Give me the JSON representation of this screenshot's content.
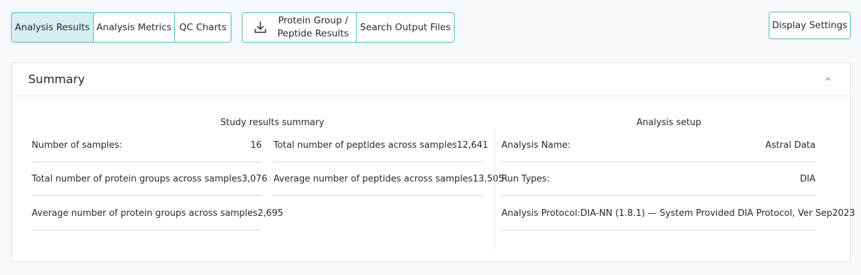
{
  "toolbar": {
    "tabs": [
      {
        "label": "Analysis Results",
        "active": true
      },
      {
        "label": "Analysis Metrics",
        "active": false
      },
      {
        "label": "QC Charts",
        "active": false
      }
    ],
    "protein_group_label": "Protein Group / Peptide Results",
    "search_output_label": "Search Output Files",
    "display_settings_label": "Display Settings"
  },
  "summary": {
    "title": "Summary",
    "study": {
      "title": "Study results summary",
      "left_rows": [
        {
          "label": "Number of samples:",
          "value": "16"
        },
        {
          "label": "Total number of protein groups across samples",
          "value": "3,076"
        },
        {
          "label": "Average number of protein groups across samples",
          "value": "2,695"
        }
      ],
      "right_rows": [
        {
          "label": "Total number of peptides across samples",
          "value": "12,641"
        },
        {
          "label": "Average number of peptides across samples",
          "value": "13,505"
        }
      ]
    },
    "setup": {
      "title": "Analysis setup",
      "rows": [
        {
          "label": "Analysis Name:",
          "value": "Astral Data"
        },
        {
          "label": "Run Types:",
          "value": "DIA"
        },
        {
          "label": "Analysis Protocol:",
          "value": "DIA-NN (1.8.1) — System Provided DIA Protocol, Ver Sep2023"
        }
      ]
    }
  },
  "colors": {
    "accent": "#53b8bd",
    "active_tab_bg": "#d7eef0"
  },
  "icons": {
    "download": "download-icon",
    "collapse": "chevron-up-icon"
  }
}
